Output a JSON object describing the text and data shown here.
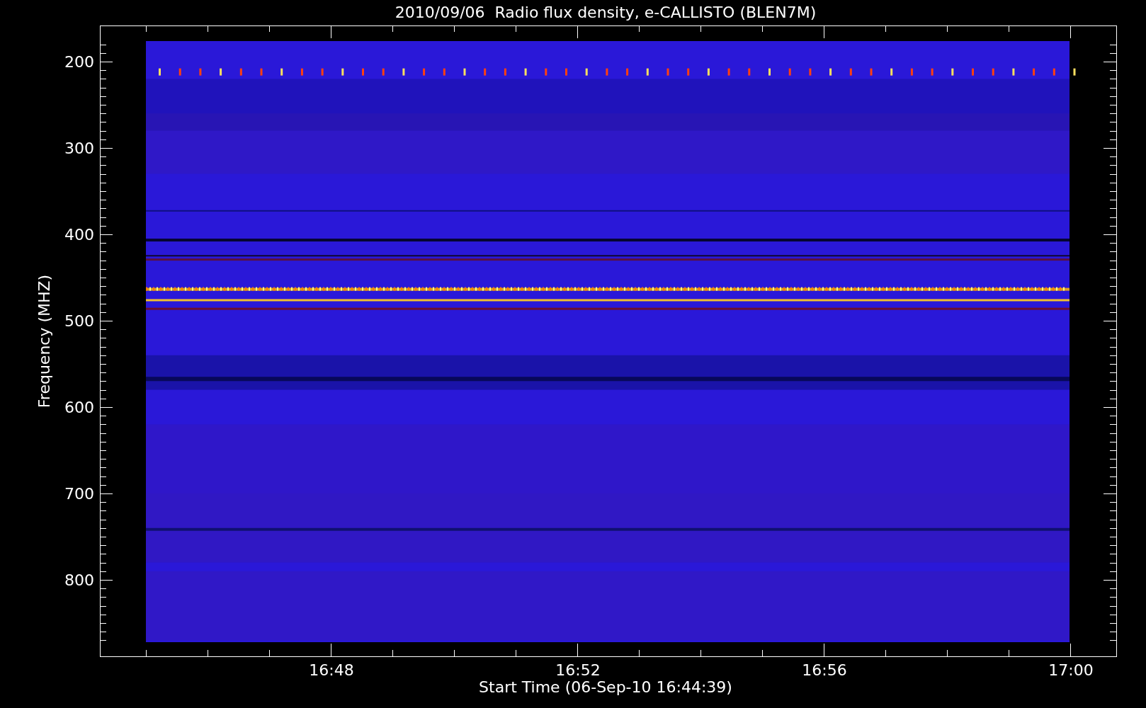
{
  "title": "2010/09/06  Radio flux density, e-CALLISTO (BLEN7M)",
  "y_axis": {
    "label": "Frequency (MHZ)",
    "ticks": [
      "200",
      "300",
      "400",
      "500",
      "600",
      "700",
      "800"
    ]
  },
  "x_axis": {
    "label": "Start Time (06-Sep-10 16:44:39)",
    "ticks": [
      "16:48",
      "16:52",
      "16:56",
      "17:00"
    ]
  }
}
